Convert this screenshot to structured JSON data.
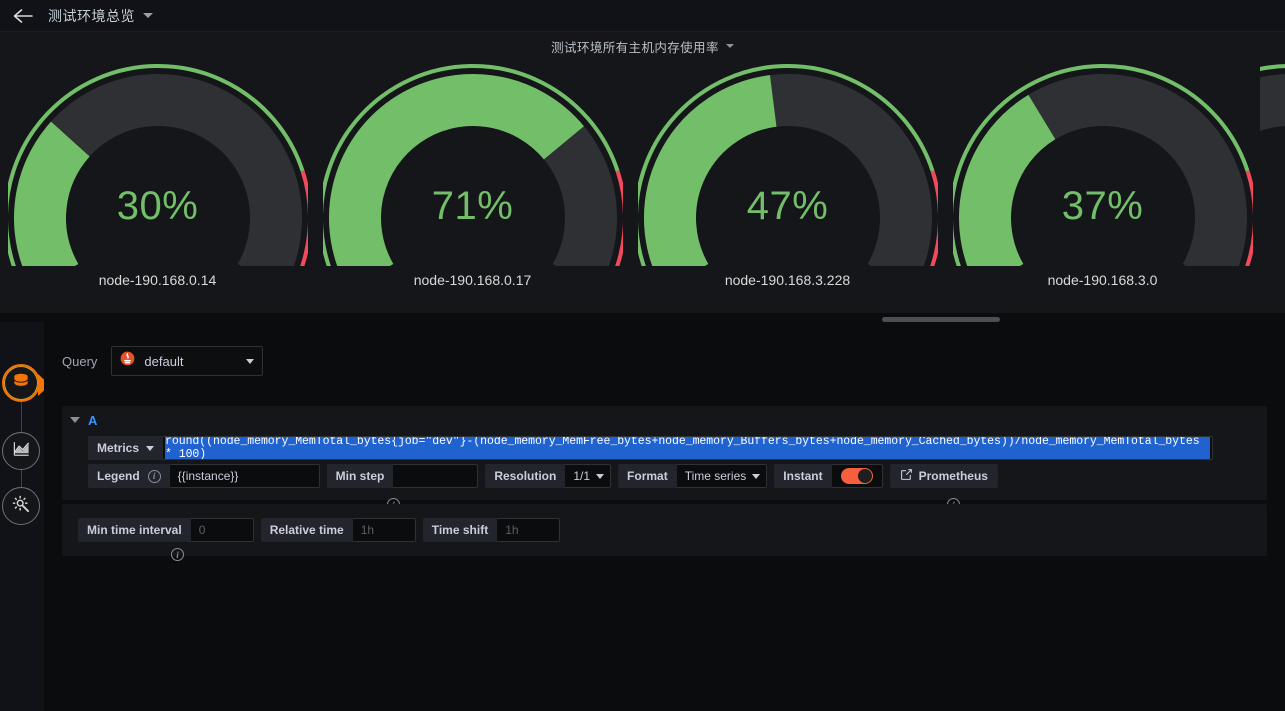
{
  "topnav": {
    "back_icon": "arrow-left-icon",
    "dashboard_title": "测试环境总览",
    "chevron_icon": "chevron-down-icon"
  },
  "panel": {
    "title": "测试环境所有主机内存使用率",
    "menu_icon": "chevron-down-icon",
    "splitter": "resize-handle",
    "value_color": "#73bf69",
    "track_color": "#2f3033",
    "threshold_ok_color": "#73bf69",
    "threshold_crit_color": "#f2495c",
    "gauges": [
      {
        "value": "30%",
        "percent": 30,
        "label": "node-190.168.0.14"
      },
      {
        "value": "71%",
        "percent": 71,
        "label": "node-190.168.0.17"
      },
      {
        "value": "47%",
        "percent": 47,
        "label": "node-190.168.3.228"
      },
      {
        "value": "37%",
        "percent": 37,
        "label": "node-190.168.3.0"
      }
    ]
  },
  "rail": {
    "items": [
      {
        "name": "query-step",
        "icon": "database-icon",
        "state": "active"
      },
      {
        "name": "visualization-step",
        "icon": "chart-icon",
        "state": "inactive"
      },
      {
        "name": "settings-step",
        "icon": "gear-wrench-icon",
        "state": "inactive"
      }
    ]
  },
  "editor": {
    "query_label": "Query",
    "datasource": {
      "name": "default",
      "icon": "prometheus-icon",
      "chevron": "chevron-down-icon"
    },
    "query_row": {
      "ref_id": "A",
      "collapse_icon": "chevron-down-icon",
      "metrics_label": "Metrics",
      "metrics_chevron": "chevron-down-icon",
      "expression": "round((node_memory_MemTotal_bytes{job=\"dev\"}-(node_memory_MemFree_bytes+node_memory_Buffers_bytes+node_memory_Cached_bytes))/node_memory_MemTotal_bytes * 100)",
      "expression_selected": true,
      "legend_label": "Legend",
      "legend_info_icon": "info-icon",
      "legend_value": "{{instance}}",
      "min_step_label": "Min step",
      "min_step_value": "",
      "min_step_info_icon": "info-icon",
      "resolution_label": "Resolution",
      "resolution_value": "1/1",
      "resolution_chevron": "chevron-down-icon",
      "format_label": "Format",
      "format_value": "Time series",
      "format_chevron": "chevron-down-icon",
      "instant_label": "Instant",
      "instant_toggle_on": true,
      "instant_toggle_color": "#f55f3e",
      "prometheus_label": "Prometheus",
      "prometheus_icon": "external-link-icon",
      "prometheus_info_icon": "info-icon"
    },
    "options_row": {
      "min_time_interval_label": "Min time interval",
      "min_time_interval_placeholder": "0",
      "min_time_interval_info_icon": "info-icon",
      "relative_time_label": "Relative time",
      "relative_time_placeholder": "1h",
      "time_shift_label": "Time shift",
      "time_shift_placeholder": "1h"
    }
  }
}
